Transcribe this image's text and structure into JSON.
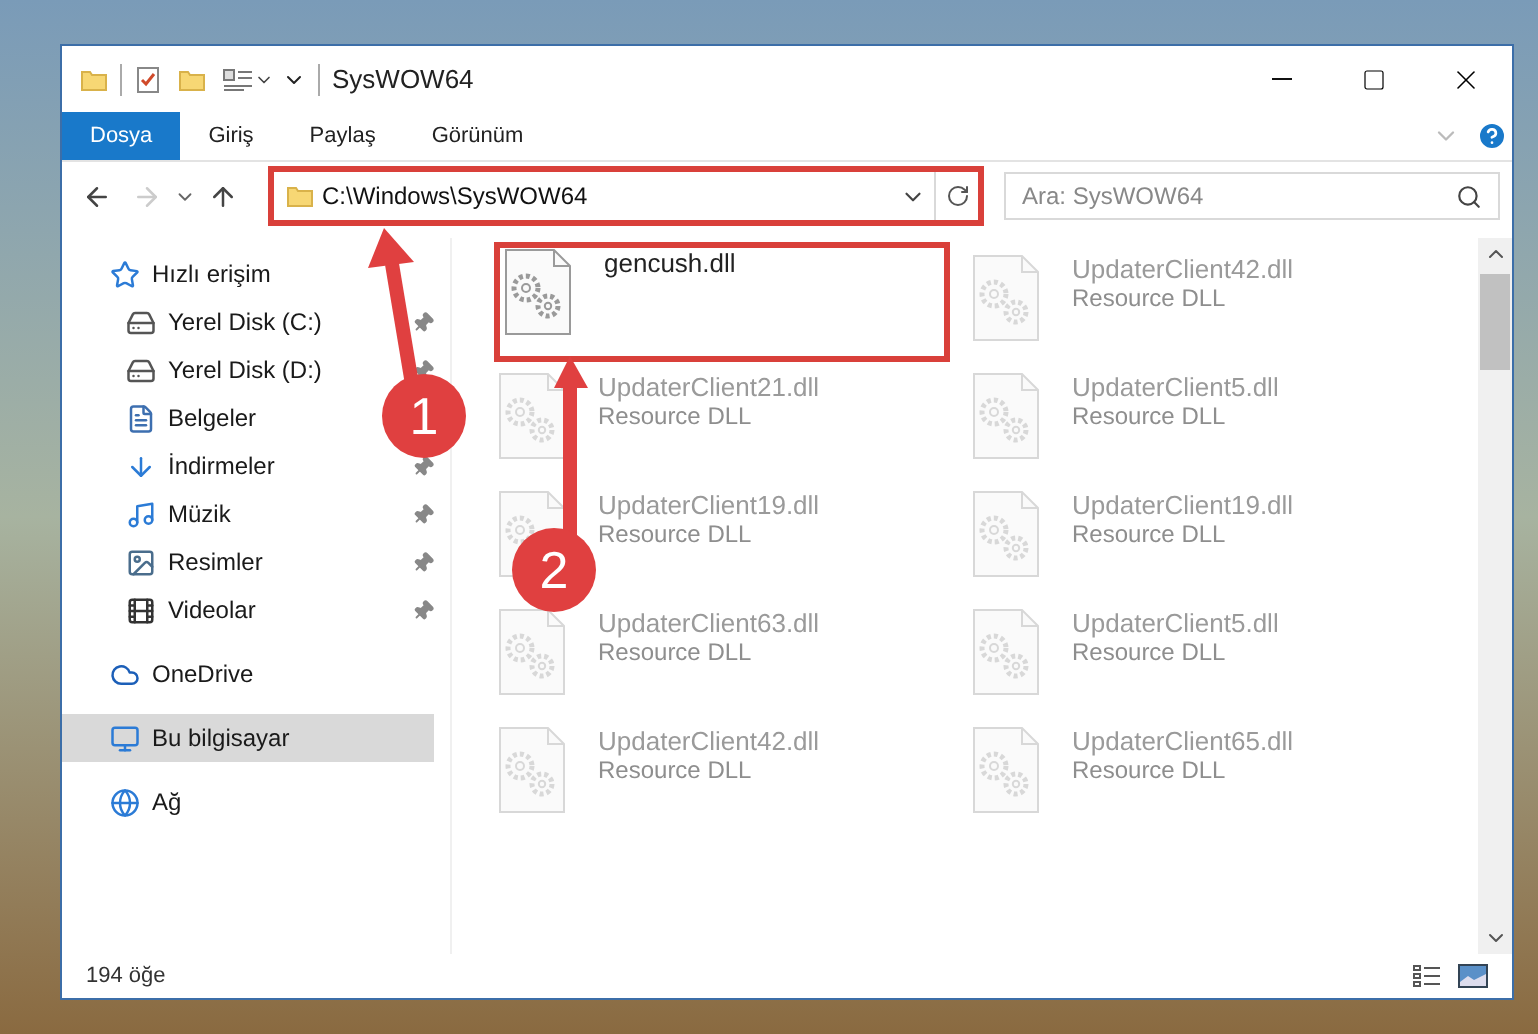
{
  "window": {
    "title": "SysWOW64"
  },
  "ribbon_tabs": [
    {
      "label": "Dosya",
      "selected": true
    },
    {
      "label": "Giriş",
      "selected": false
    },
    {
      "label": "Paylaş",
      "selected": false
    },
    {
      "label": "Görünüm",
      "selected": false
    }
  ],
  "navigation": {
    "forward_disabled": true
  },
  "address_bar": {
    "path": "C:\\Windows\\SysWOW64",
    "highlighted": true
  },
  "search": {
    "placeholder": "Ara: SysWOW64"
  },
  "sidebar": {
    "items": [
      {
        "label": "Hızlı erişim",
        "kind": "star",
        "selected": false,
        "children": [
          {
            "label": "Yerel Disk (C:)",
            "kind": "drive",
            "selected": false,
            "pinned": true
          },
          {
            "label": "Yerel Disk (D:)",
            "kind": "drive",
            "selected": false,
            "pinned": true
          },
          {
            "label": "Belgeler",
            "kind": "document",
            "selected": false
          },
          {
            "label": "İndirmeler",
            "kind": "download",
            "selected": false,
            "pinned": true
          },
          {
            "label": "Müzik",
            "kind": "music",
            "selected": false,
            "pinned": true
          },
          {
            "label": "Resimler",
            "kind": "picture",
            "selected": false,
            "pinned": true
          },
          {
            "label": "Videolar",
            "kind": "video",
            "selected": false,
            "pinned": true
          }
        ]
      },
      {
        "label": "OneDrive",
        "kind": "cloud",
        "selected": false
      },
      {
        "label": "Bu bilgisayar",
        "kind": "computer",
        "selected": true
      },
      {
        "label": "Ağ",
        "kind": "network",
        "selected": false
      }
    ]
  },
  "files": [
    {
      "name": "gencush.dll",
      "faded": false,
      "highlighted": true
    },
    {
      "name": "UpdaterClient42.dll",
      "type": "Resource DLL",
      "faded": true,
      "highlighted": false
    },
    {
      "name": "UpdaterClient21.dll",
      "type": "Resource DLL",
      "faded": true,
      "highlighted": false
    },
    {
      "name": "UpdaterClient5.dll",
      "type": "Resource DLL",
      "faded": true,
      "highlighted": false
    },
    {
      "name": "UpdaterClient19.dll",
      "type": "Resource DLL",
      "faded": true,
      "highlighted": false
    },
    {
      "name": "UpdaterClient19.dll",
      "type": "Resource DLL",
      "faded": true,
      "highlighted": false
    },
    {
      "name": "UpdaterClient63.dll",
      "type": "Resource DLL",
      "faded": true,
      "highlighted": false
    },
    {
      "name": "UpdaterClient5.dll",
      "type": "Resource DLL",
      "faded": true,
      "highlighted": false
    },
    {
      "name": "UpdaterClient42.dll",
      "type": "Resource DLL",
      "faded": true,
      "highlighted": false
    },
    {
      "name": "UpdaterClient65.dll",
      "type": "Resource DLL",
      "faded": true,
      "highlighted": false
    }
  ],
  "status_bar": {
    "item_count": "194 öğe"
  },
  "annotations": [
    {
      "number": "1"
    },
    {
      "number": "2"
    }
  ]
}
